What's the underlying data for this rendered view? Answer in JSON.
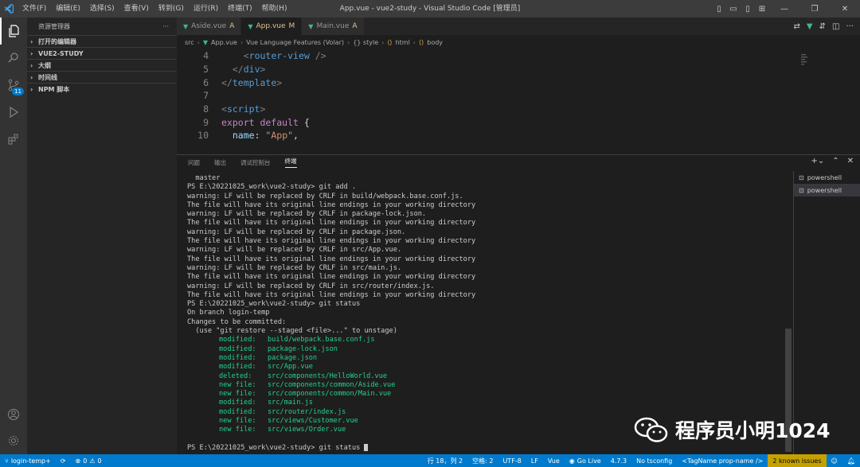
{
  "window": {
    "title": "App.vue - vue2-study - Visual Studio Code [管理员]",
    "menu": [
      "文件(F)",
      "编辑(E)",
      "选择(S)",
      "查看(V)",
      "转到(G)",
      "运行(R)",
      "终端(T)",
      "帮助(H)"
    ]
  },
  "activity": {
    "scm_badge": "11"
  },
  "sidebar": {
    "header": "资源管理器",
    "more": "···",
    "sections": [
      "打开的编辑器",
      "VUE2-STUDY",
      "大纲",
      "时间线",
      "NPM 脚本"
    ]
  },
  "tabs": [
    {
      "name": "Aside.vue",
      "status": "A"
    },
    {
      "name": "App.vue",
      "status": "M"
    },
    {
      "name": "Main.vue",
      "status": "A"
    }
  ],
  "breadcrumb": [
    "src",
    "App.vue",
    "Vue Language Features (Volar)",
    "{} style",
    "html",
    "body"
  ],
  "code": {
    "line_numbers": [
      "4",
      "5",
      "6",
      "7",
      "8",
      "9",
      "10"
    ]
  },
  "panel": {
    "tabs": [
      "问题",
      "输出",
      "调试控制台",
      "终端"
    ],
    "terminal_lines": [
      "  master",
      "PS E:\\20221025_work\\vue2-study> git add .",
      "warning: LF will be replaced by CRLF in build/webpack.base.conf.js.",
      "The file will have its original line endings in your working directory",
      "warning: LF will be replaced by CRLF in package-lock.json.",
      "The file will have its original line endings in your working directory",
      "warning: LF will be replaced by CRLF in package.json.",
      "The file will have its original line endings in your working directory",
      "warning: LF will be replaced by CRLF in src/App.vue.",
      "The file will have its original line endings in your working directory",
      "warning: LF will be replaced by CRLF in src/main.js.",
      "The file will have its original line endings in your working directory",
      "warning: LF will be replaced by CRLF in src/router/index.js.",
      "The file will have its original line endings in your working directory",
      "PS E:\\20221025_work\\vue2-study> git status",
      "On branch login-temp",
      "Changes to be committed:",
      "  (use \"git restore --staged <file>...\" to unstage)"
    ],
    "changes": [
      {
        "kind": "modified:",
        "path": "build/webpack.base.conf.js"
      },
      {
        "kind": "modified:",
        "path": "package-lock.json"
      },
      {
        "kind": "modified:",
        "path": "package.json"
      },
      {
        "kind": "modified:",
        "path": "src/App.vue"
      },
      {
        "kind": "deleted:",
        "path": "src/components/HelloWorld.vue"
      },
      {
        "kind": "new file:",
        "path": "src/components/common/Aside.vue"
      },
      {
        "kind": "new file:",
        "path": "src/components/common/Main.vue"
      },
      {
        "kind": "modified:",
        "path": "src/main.js"
      },
      {
        "kind": "modified:",
        "path": "src/router/index.js"
      },
      {
        "kind": "new file:",
        "path": "src/views/Customer.vue"
      },
      {
        "kind": "new file:",
        "path": "src/views/Order.vue"
      }
    ],
    "prompt": "PS E:\\20221025_work\\vue2-study> git status",
    "terminals": [
      "powershell",
      "powershell"
    ]
  },
  "watermark": "程序员小明1024",
  "status": {
    "branch": "login-temp+",
    "errors": "0",
    "warnings": "0",
    "position": "行 18，列 2",
    "spaces": "空格: 2",
    "encoding": "UTF-8",
    "eol": "LF",
    "language": "Vue",
    "golive": "Go Live",
    "version": "4.7.3",
    "tsconfig": "No tsconfig",
    "tag": "<TagName prop-name />",
    "issues": "2 known issues"
  },
  "colors": {
    "accent": "#007acc",
    "vue": "#41b883",
    "git_added": "#23d18b",
    "modified_tab": "#e2c08d"
  }
}
